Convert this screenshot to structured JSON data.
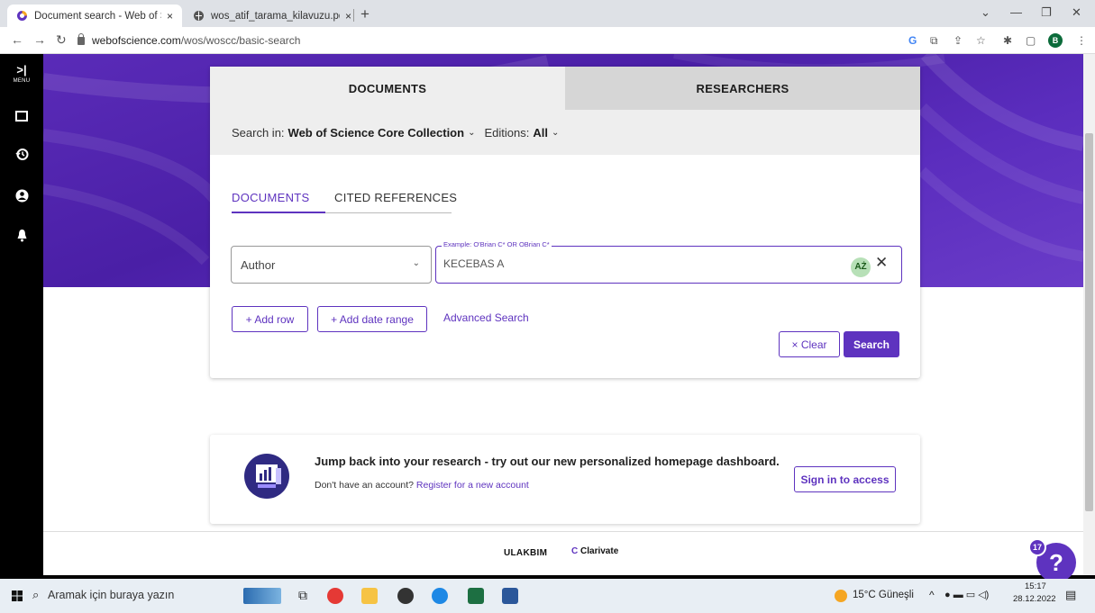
{
  "browser": {
    "tabs": [
      {
        "title": "Document search - Web of Scien",
        "active": true
      },
      {
        "title": "wos_atif_tarama_kilavuzu.pdf",
        "active": false
      }
    ],
    "new_tab": "+",
    "tab_close": "×",
    "url_host": "webofscience.com",
    "url_path": "/wos/woscc/basic-search",
    "profile_initial": "B"
  },
  "rail": {
    "menu_label": "MENU",
    "items": [
      "folder-icon",
      "history-icon",
      "account-icon",
      "bell-icon"
    ]
  },
  "search": {
    "tabs": {
      "documents": "DOCUMENTS",
      "researchers": "RESEARCHERS"
    },
    "search_in_label": "Search in:",
    "collection": "Web of Science Core Collection",
    "editions_label": "Editions:",
    "editions_value": "All",
    "subtabs": {
      "documents": "DOCUMENTS",
      "cited_references": "CITED REFERENCES"
    },
    "field": "Author",
    "query_legend": "Example: O'Brian C* OR OBrian C*",
    "query_value": "KECEBAS A",
    "az_badge": "AŻ",
    "add_row": "+ Add row",
    "add_date_range": "+ Add date range",
    "advanced_search": "Advanced Search",
    "clear": "× Clear",
    "search": "Search"
  },
  "promo": {
    "title": "Jump back into your research - try out our new personalized homepage dashboard.",
    "no_account": "Don't have an account?",
    "register_link": "Register for a new account",
    "sign_in": "Sign in to access"
  },
  "footer": {
    "partner": "ULAKBIM",
    "brand": "Clarivate"
  },
  "help": {
    "badge_count": "17",
    "label": "?"
  },
  "taskbar": {
    "search_placeholder": "Aramak için buraya yazın",
    "weather": "15°C Güneşli",
    "time": "15:17",
    "date": "28.12.2022"
  },
  "colors": {
    "accent": "#5e33bf",
    "hero": "#4a1fa6"
  }
}
